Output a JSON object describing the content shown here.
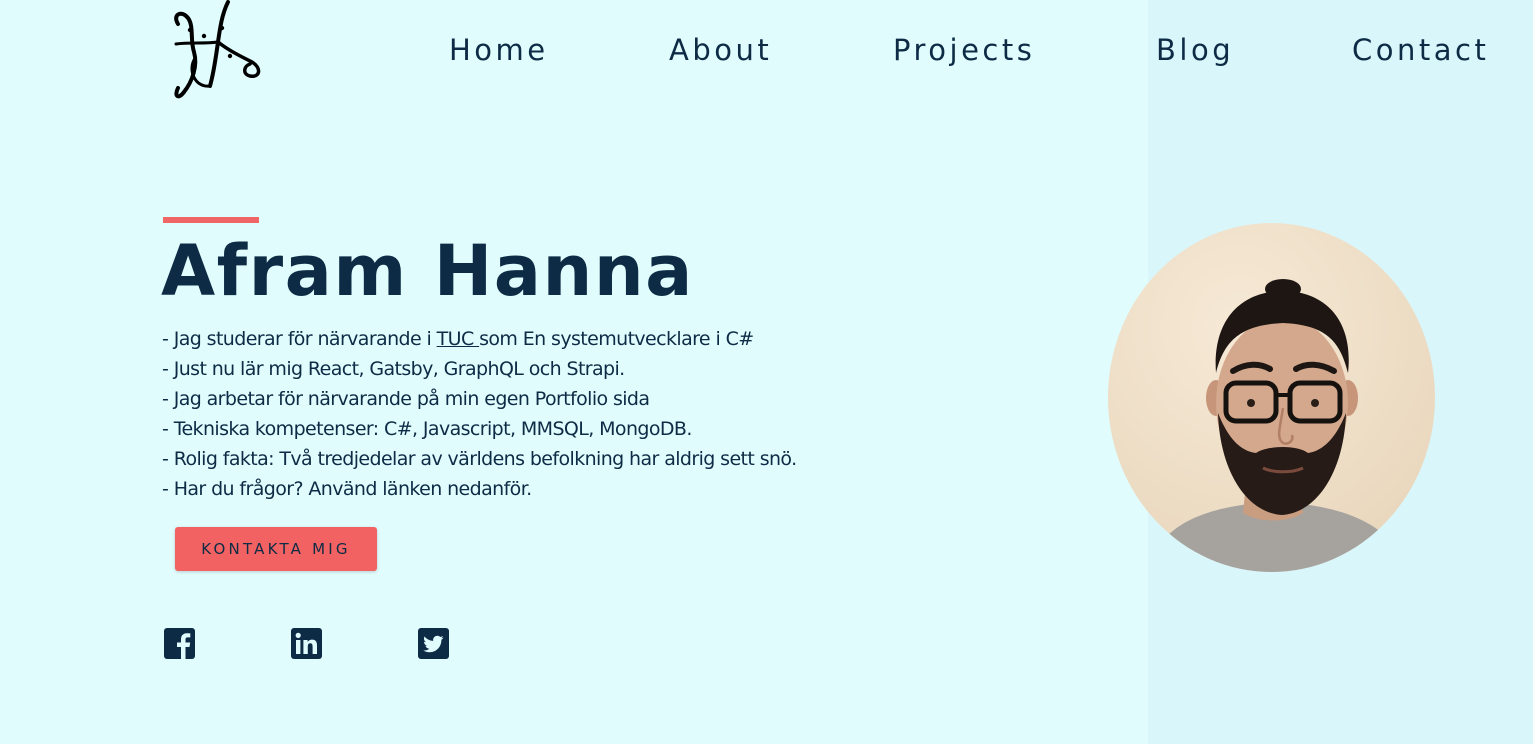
{
  "site": {
    "logo_icon": "monogram-logo-icon"
  },
  "nav": {
    "items": [
      {
        "label": "Home"
      },
      {
        "label": "About"
      },
      {
        "label": "Projects"
      },
      {
        "label": "Blog"
      },
      {
        "label": "Contact"
      }
    ]
  },
  "hero": {
    "name": "Afram Hanna",
    "bio": [
      {
        "prefix": "- Jag studerar för närvarande i ",
        "link": "TUC ",
        "suffix": "som En systemutvecklare i C#"
      },
      {
        "text": "- Just nu lär mig React, Gatsby, GraphQL och Strapi."
      },
      {
        "text": "- Jag arbetar för närvarande på min egen Portfolio sida"
      },
      {
        "text": "- Tekniska kompetenser: C#, Javascript, MMSQL, MongoDB."
      },
      {
        "text": "- Rolig fakta: Två tredjedelar av världens befolkning har aldrig sett snö."
      },
      {
        "text": "- Har du frågor? Använd länken nedanför."
      }
    ],
    "cta_label": "KONTAKTA MIG"
  },
  "social": {
    "icons": [
      "facebook-icon",
      "linkedin-icon",
      "twitter-icon"
    ]
  },
  "colors": {
    "background": "#e0fcfd",
    "panel": "#d9f6fb",
    "text": "#0d2b45",
    "accent": "#f26262"
  }
}
